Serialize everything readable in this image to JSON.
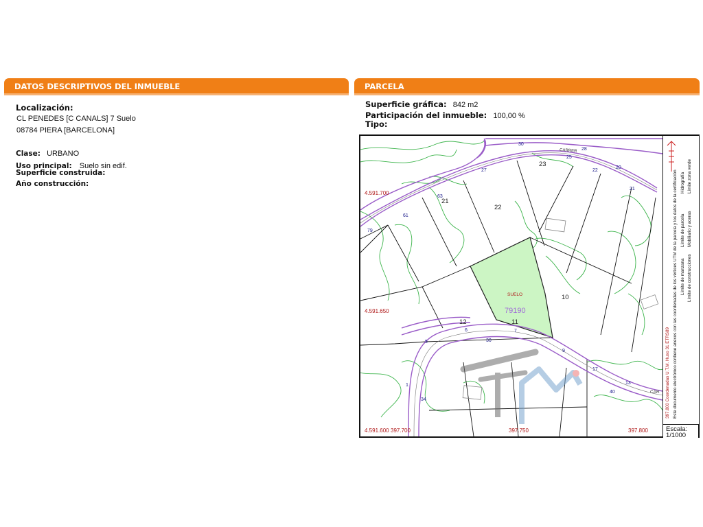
{
  "left_panel": {
    "header": "DATOS DESCRIPTIVOS DEL INMUEBLE",
    "localizacion_label": "Localización:",
    "address_line1": "CL PENEDES [C CANALS] 7 Suelo",
    "address_line2": "08784 PIERA [BARCELONA]",
    "clase_label": "Clase:",
    "clase_value": "URBANO",
    "uso_label": "Uso principal:",
    "uso_value": "Suelo sin edif.",
    "superficie_construida_label": "Superficie construida:",
    "anio_label": "Año construcción:"
  },
  "right_panel": {
    "header": "PARCELA",
    "superficie_label": "Superficie gráfica:",
    "superficie_value": "842 m2",
    "participacion_label": "Participación del inmueble:",
    "participacion_value": "100,00 %",
    "tipo_label": "Tipo:"
  },
  "map": {
    "parcel_id": "79190",
    "parcel_tag": "SUELO",
    "street_labels": [
      "CARRER",
      "CAR"
    ],
    "coordinates": {
      "y_top": "4.591.700",
      "y_mid": "4.591.650",
      "y_bottom": "4.591.600",
      "x_left": "397.700",
      "x_mid": "397.750",
      "x_right": "397.800"
    },
    "plot_numbers": [
      "21",
      "22",
      "23",
      "10",
      "11",
      "12"
    ],
    "street_numbers": [
      "30",
      "28",
      "25",
      "22",
      "20",
      "21",
      "27",
      "63",
      "61",
      "79",
      "6",
      "5",
      "30",
      "7",
      "9",
      "17",
      "13",
      "40",
      "34",
      "1"
    ],
    "legend": {
      "line1": "Límite de manzana",
      "line2": "Límite de parcela",
      "line3": "Hidrografía",
      "line4": "Límite de construcciones",
      "line5": "Mobiliario y aceras",
      "line6": "Límite zona verde",
      "coord_note": "397.800 Coordenadas U.T.M. Huso 31 ETRS89",
      "cert_note": "Este documento electrónico contiene anexos con las coordenadas de los vértices UTM de la parcela y los datos de la certificación"
    },
    "scale_label": "Escala:",
    "scale_value": "1/1000"
  },
  "colors": {
    "header_orange": "#f07f16",
    "parcel_fill": "#ccf5c4",
    "street_purple": "#9a5cc8",
    "contour_green": "#3cb44b",
    "coord_red": "#b01818"
  }
}
